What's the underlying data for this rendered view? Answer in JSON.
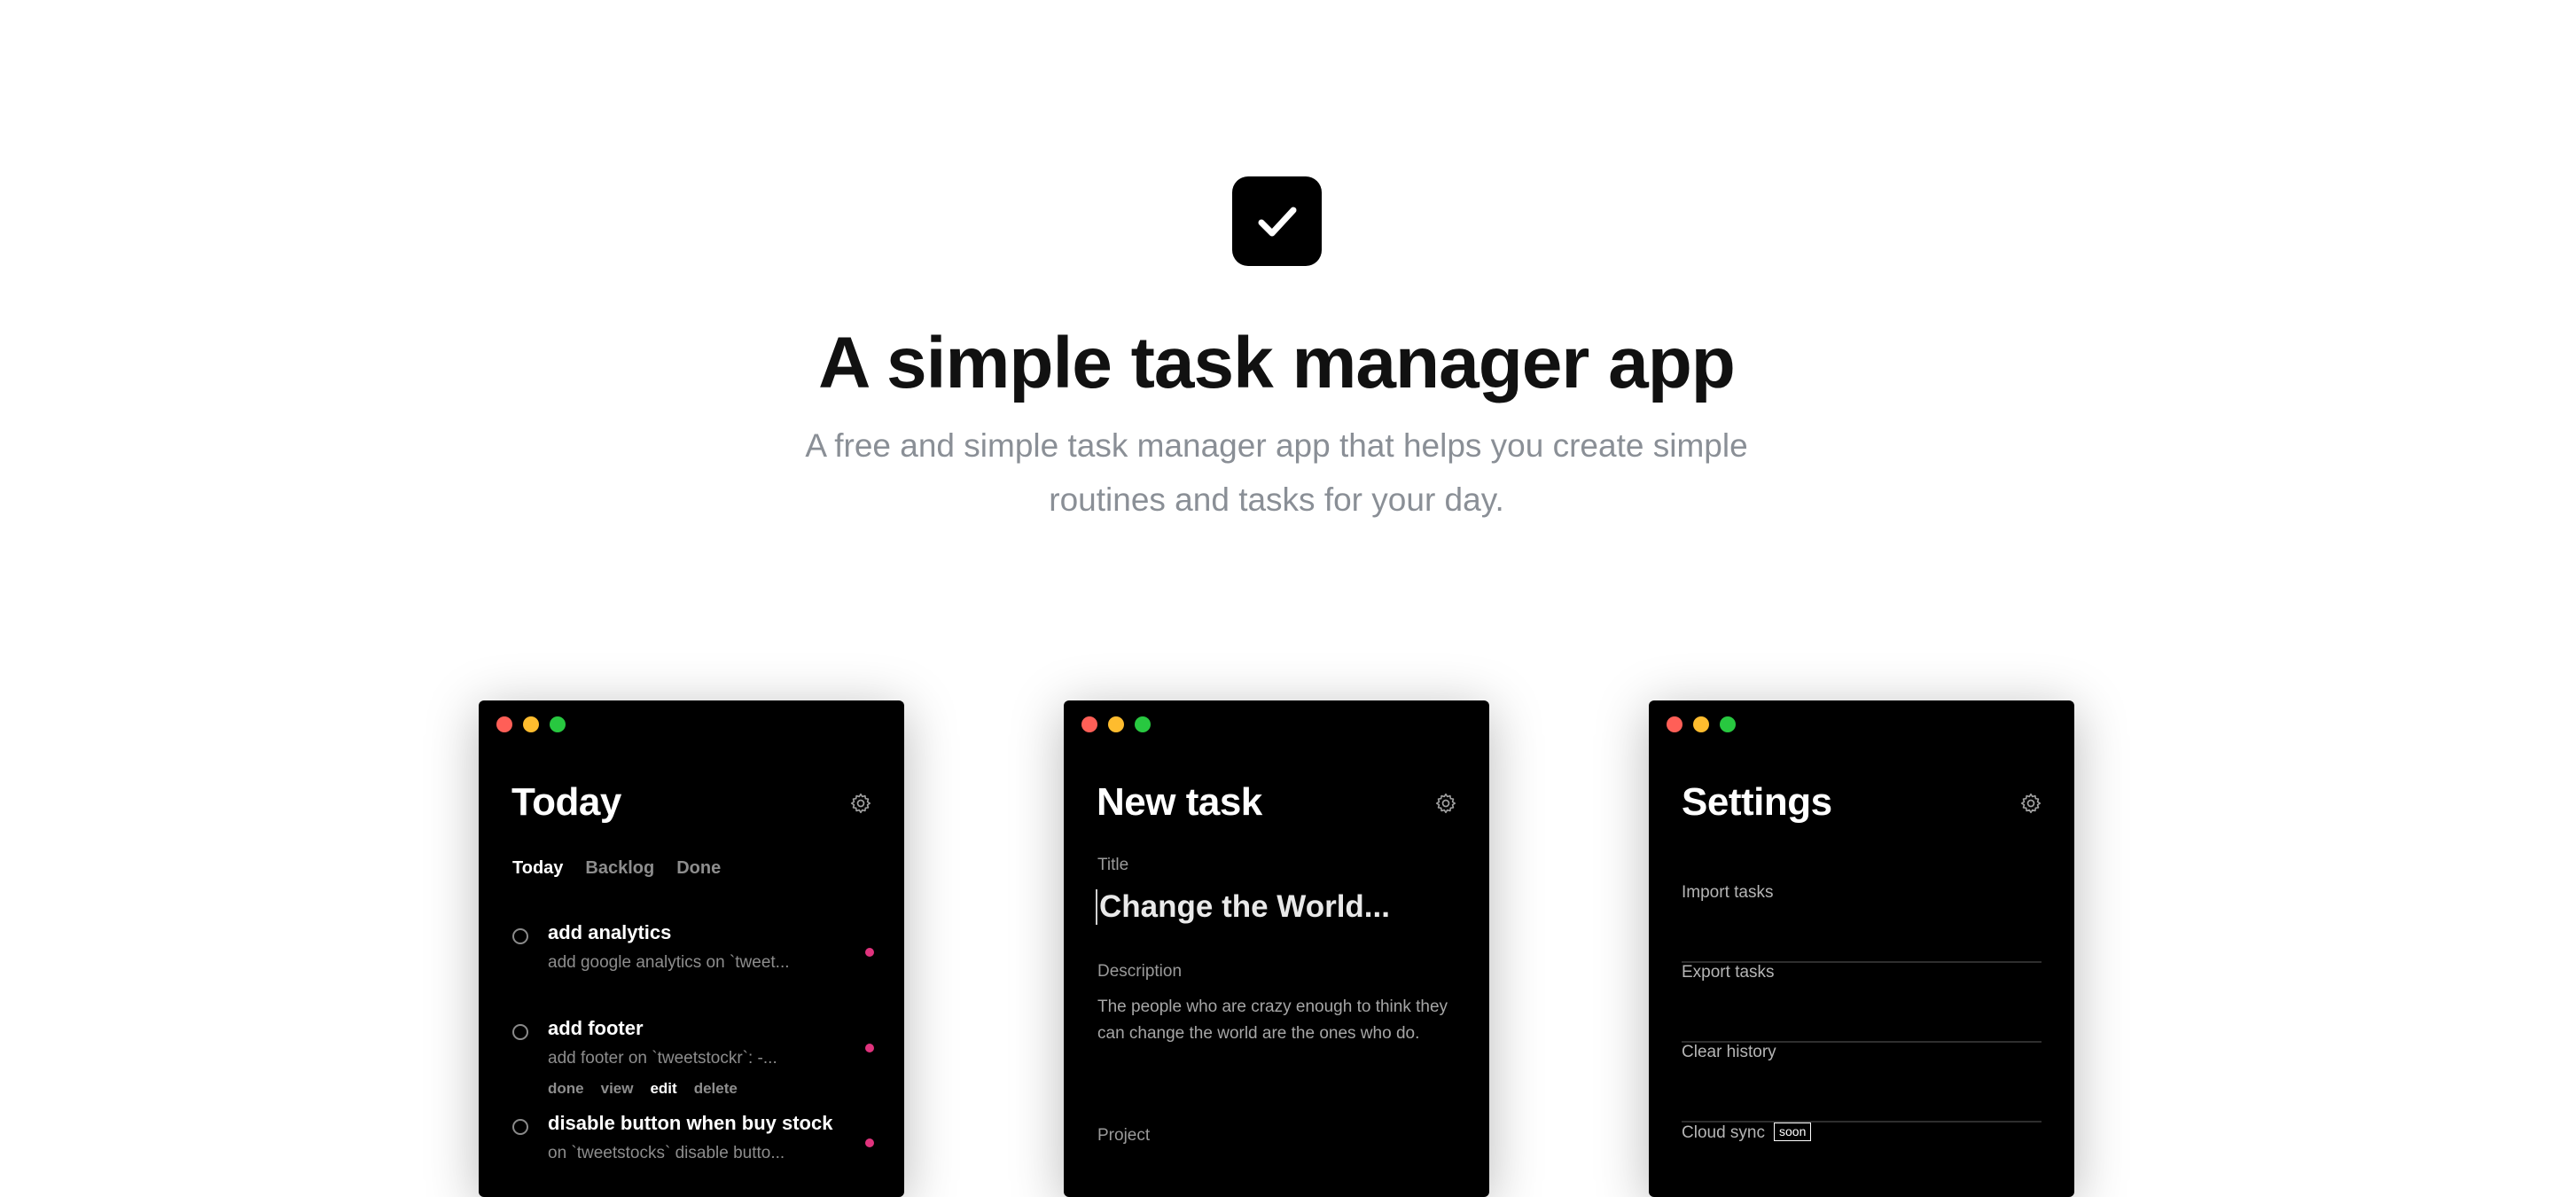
{
  "hero": {
    "icon": "checkmark-icon",
    "title": "A simple task manager app",
    "subtitle": "A free and simple task manager app that helps you create simple routines and tasks for your day."
  },
  "colors": {
    "traffic_red": "#ff5f57",
    "traffic_yellow": "#febc2e",
    "traffic_green": "#28c840",
    "tag_pink": "#e0337d"
  },
  "windows": {
    "today": {
      "title": "Today",
      "gear_icon": "gear-icon",
      "tabs": [
        "Today",
        "Backlog",
        "Done"
      ],
      "active_tab": "Today",
      "tasks": [
        {
          "title": "add analytics",
          "description": "add google analytics on `tweet..."
        },
        {
          "title": "add footer",
          "description": "add footer on `tweetstockr`: -...",
          "actions": [
            "done",
            "view",
            "edit",
            "delete"
          ]
        },
        {
          "title": "disable button when buy stock",
          "description": "on `tweetstocks` disable butto..."
        }
      ]
    },
    "new_task": {
      "title": "New task",
      "gear_icon": "gear-icon",
      "title_label": "Title",
      "title_value": "Change the World...",
      "description_label": "Description",
      "description_value": "The people who are crazy enough to think they can change the world are the ones who do.",
      "project_label": "Project"
    },
    "settings": {
      "title": "Settings",
      "gear_icon": "gear-icon",
      "items": [
        "Import tasks",
        "Export tasks",
        "Clear history",
        "Cloud sync"
      ],
      "badge": "soon"
    }
  }
}
